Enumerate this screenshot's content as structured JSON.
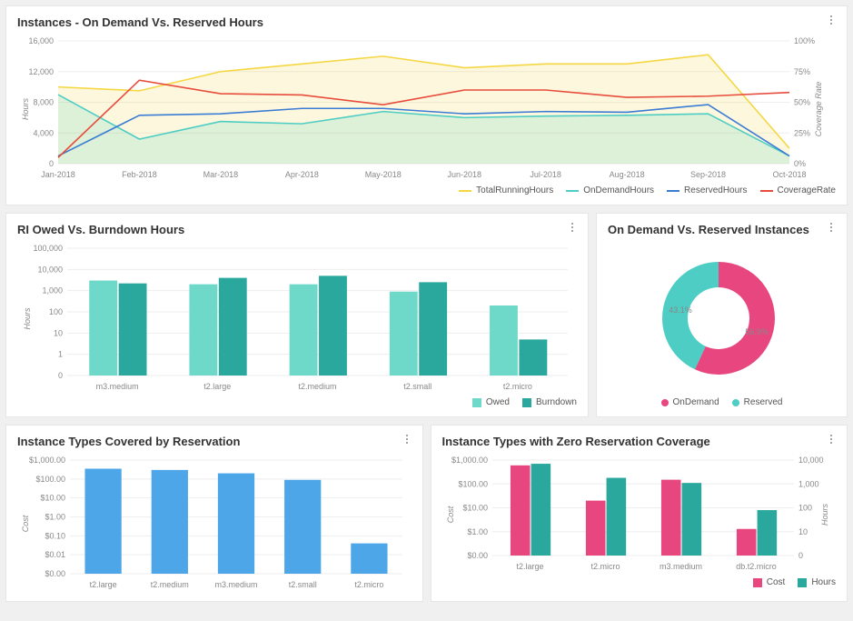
{
  "colors": {
    "yellow": "#f5d742",
    "teal": "#4ecdc4",
    "blue": "#3a7bd5",
    "red": "#e74c3c",
    "tealLight": "#6ed9c9",
    "tealDark": "#2aa89e",
    "pink": "#e8467f",
    "skyBlue": "#4da6e8"
  },
  "panel1": {
    "title": "Instances - On Demand Vs. Reserved Hours",
    "ylabel": "Hours",
    "y2label": "Coverage Rate",
    "legend": [
      "TotalRunningHours",
      "OnDemandHours",
      "ReservedHours",
      "CoverageRate"
    ]
  },
  "panel2": {
    "title": "RI Owed Vs. Burndown Hours",
    "ylabel": "Hours",
    "legend": [
      "Owed",
      "Burndown"
    ]
  },
  "panel3": {
    "title": "On Demand Vs. Reserved Instances",
    "legend": [
      "OnDemand",
      "Reserved"
    ],
    "labels": {
      "onDemand": "56.9%",
      "reserved": "43.1%"
    }
  },
  "panel4": {
    "title": "Instance Types Covered by Reservation",
    "ylabel": "Cost"
  },
  "panel5": {
    "title": "Instance Types with Zero Reservation Coverage",
    "ylabel": "Cost",
    "y2label": "Hours",
    "legend": [
      "Cost",
      "Hours"
    ]
  },
  "chart_data": [
    {
      "id": "instances_ondemand_vs_reserved_hours",
      "type": "line",
      "title": "Instances - On Demand Vs. Reserved Hours",
      "x": [
        "Jan-2018",
        "Feb-2018",
        "Mar-2018",
        "Apr-2018",
        "May-2018",
        "Jun-2018",
        "Jul-2018",
        "Aug-2018",
        "Sep-2018",
        "Oct-2018"
      ],
      "series": [
        {
          "name": "TotalRunningHours",
          "color": "#f5d742",
          "values": [
            10000,
            9500,
            12000,
            13000,
            14000,
            12500,
            13000,
            13000,
            14200,
            2000
          ]
        },
        {
          "name": "OnDemandHours",
          "color": "#4ecdc4",
          "values": [
            9000,
            3200,
            5500,
            5200,
            6800,
            6000,
            6200,
            6300,
            6500,
            1000
          ]
        },
        {
          "name": "ReservedHours",
          "color": "#3a7bd5",
          "values": [
            1000,
            6300,
            6500,
            7200,
            7200,
            6500,
            6800,
            6700,
            7700,
            1000
          ]
        },
        {
          "name": "CoverageRate",
          "color": "#e74c3c",
          "axis": "y2",
          "values": [
            5,
            68,
            57,
            56,
            48,
            60,
            60,
            54,
            55,
            58
          ]
        }
      ],
      "ylabel": "Hours",
      "ylim": [
        0,
        16000
      ],
      "yticks": [
        0,
        4000,
        8000,
        12000,
        16000
      ],
      "y2label": "Coverage Rate",
      "y2lim": [
        0,
        100
      ],
      "y2ticks": [
        0,
        25,
        50,
        75,
        100
      ]
    },
    {
      "id": "ri_owed_vs_burndown",
      "type": "bar",
      "title": "RI Owed Vs. Burndown Hours",
      "categories": [
        "m3.medium",
        "t2.large",
        "t2.medium",
        "t2.small",
        "t2.micro"
      ],
      "series": [
        {
          "name": "Owed",
          "color": "#6ed9c9",
          "values": [
            3000,
            2000,
            2000,
            900,
            200
          ]
        },
        {
          "name": "Burndown",
          "color": "#2aa89e",
          "values": [
            2200,
            4000,
            5000,
            2500,
            5
          ]
        }
      ],
      "ylabel": "Hours",
      "yticks": [
        0,
        1,
        10,
        100,
        1000,
        10000,
        100000
      ],
      "yscale": "log"
    },
    {
      "id": "ondemand_vs_reserved_instances",
      "type": "pie",
      "title": "On Demand Vs. Reserved Instances",
      "series": [
        {
          "name": "OnDemand",
          "color": "#e8467f",
          "value": 56.9
        },
        {
          "name": "Reserved",
          "color": "#4ecdc4",
          "value": 43.1
        }
      ]
    },
    {
      "id": "instance_types_covered_by_reservation",
      "type": "bar",
      "title": "Instance Types Covered by Reservation",
      "categories": [
        "t2.large",
        "t2.medium",
        "m3.medium",
        "t2.small",
        "t2.micro"
      ],
      "series": [
        {
          "name": "Cost",
          "color": "#4da6e8",
          "values": [
            350,
            300,
            200,
            90,
            0.04
          ]
        }
      ],
      "ylabel": "Cost",
      "yticks": [
        0.0,
        0.01,
        0.1,
        1.0,
        10.0,
        100.0,
        1000.0
      ],
      "ytick_labels": [
        "$0.00",
        "$0.01",
        "$0.10",
        "$1.00",
        "$10.00",
        "$100.00",
        "$1,000.00"
      ],
      "yscale": "log"
    },
    {
      "id": "instance_types_zero_reservation_coverage",
      "type": "bar",
      "title": "Instance Types with Zero Reservation Coverage",
      "categories": [
        "t2.large",
        "t2.micro",
        "m3.medium",
        "db.t2.micro"
      ],
      "series": [
        {
          "name": "Cost",
          "color": "#e8467f",
          "axis": "y",
          "values": [
            600,
            20,
            150,
            1.3
          ]
        },
        {
          "name": "Hours",
          "color": "#2aa89e",
          "axis": "y2",
          "values": [
            7000,
            1800,
            1100,
            80
          ]
        }
      ],
      "ylabel": "Cost",
      "yticks": [
        0.0,
        1.0,
        10.0,
        100.0,
        1000.0
      ],
      "ytick_labels": [
        "$0.00",
        "$1.00",
        "$10.00",
        "$100.00",
        "$1,000.00"
      ],
      "y2label": "Hours",
      "y2ticks": [
        0,
        10,
        100,
        1000,
        10000
      ],
      "yscale": "log"
    }
  ]
}
